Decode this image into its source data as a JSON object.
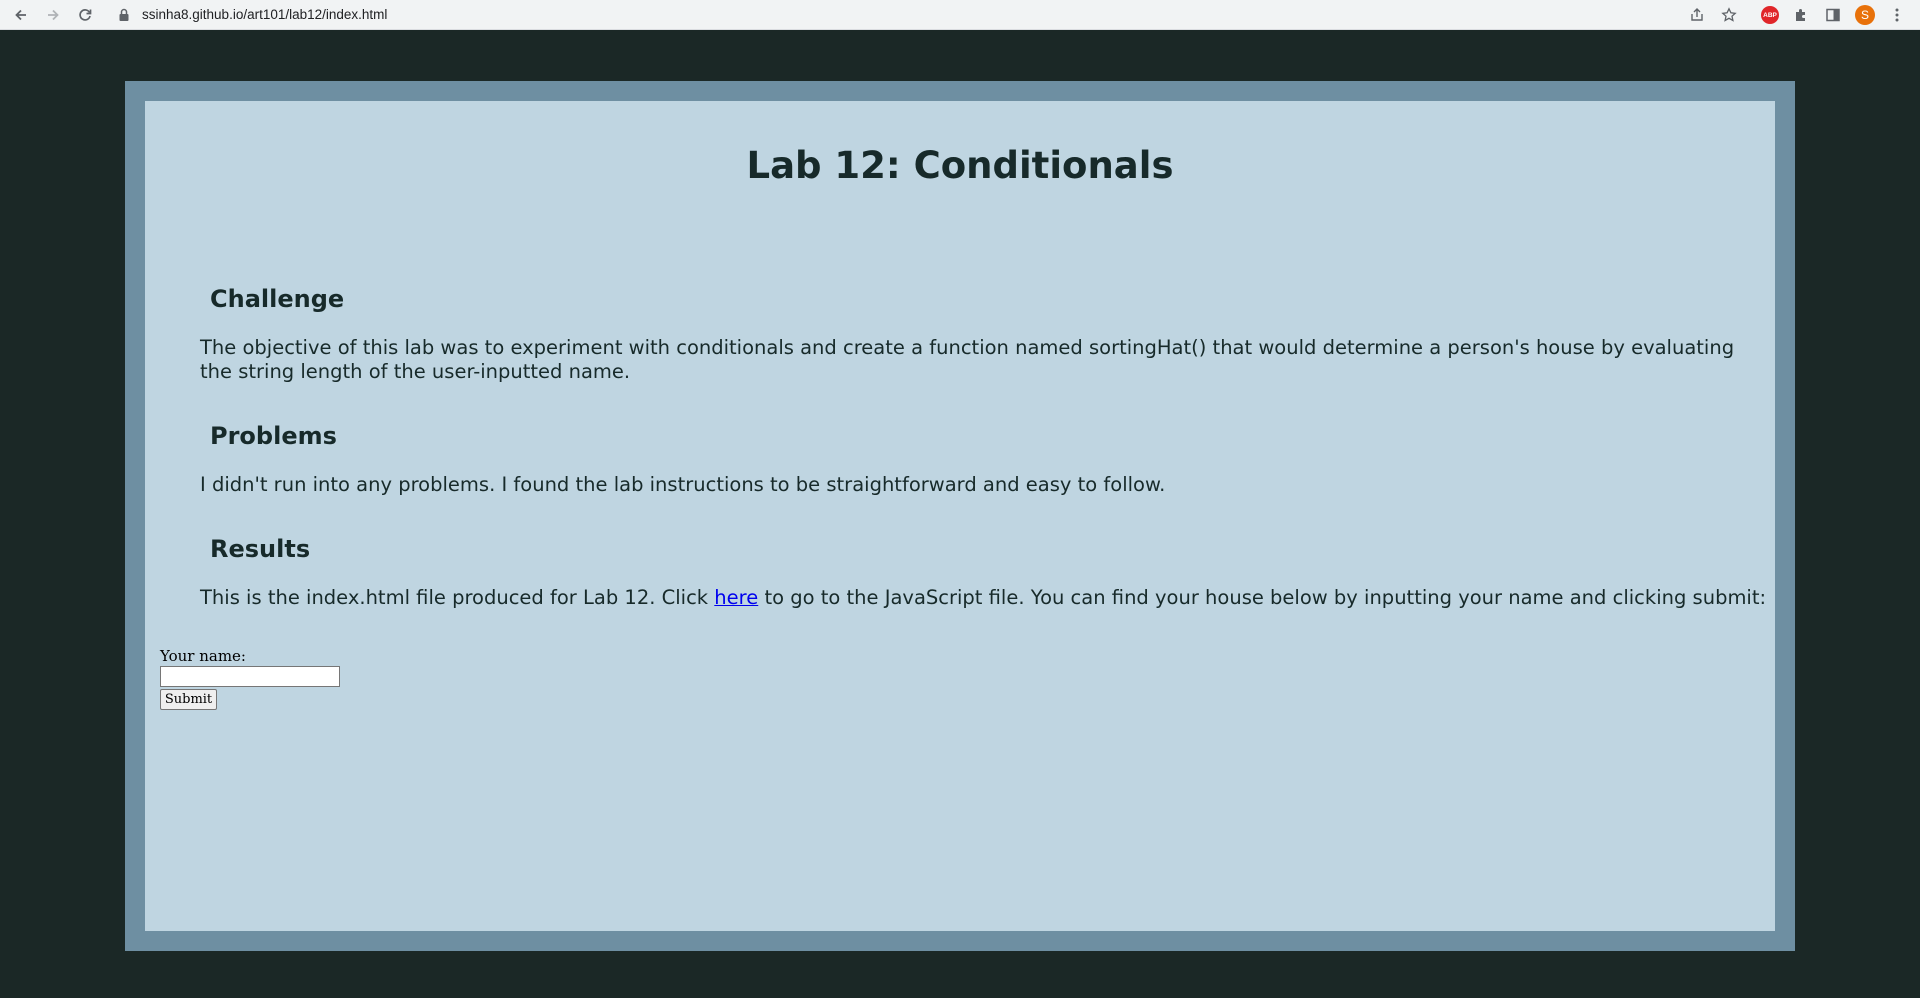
{
  "browser": {
    "url": "ssinha8.github.io/art101/lab12/index.html",
    "avatar_letter": "S",
    "abp_label": "ABP"
  },
  "page": {
    "title": "Lab 12: Conditionals",
    "sections": [
      {
        "heading": "Challenge",
        "text": "The objective of this lab was to experiment with conditionals and create a function named sortingHat() that would determine a person's house by evaluating the string length of the user-inputted name."
      },
      {
        "heading": "Problems",
        "text": "I didn't run into any problems. I found the lab instructions to be straightforward and easy to follow."
      },
      {
        "heading": "Results",
        "text_before_link": "This is the index.html file produced for Lab 12. Click ",
        "link_text": "here",
        "text_after_link": " to go to the JavaScript file. You can find your house below by inputting your name and clicking submit:"
      }
    ],
    "form": {
      "label": "Your name:",
      "input_value": "",
      "submit_label": "Submit"
    }
  },
  "colors": {
    "background": "#1b2826",
    "frame": "#6e8fa2",
    "panel": "#bfd5e1",
    "text": "#172a2a",
    "link": "#0000ee"
  }
}
